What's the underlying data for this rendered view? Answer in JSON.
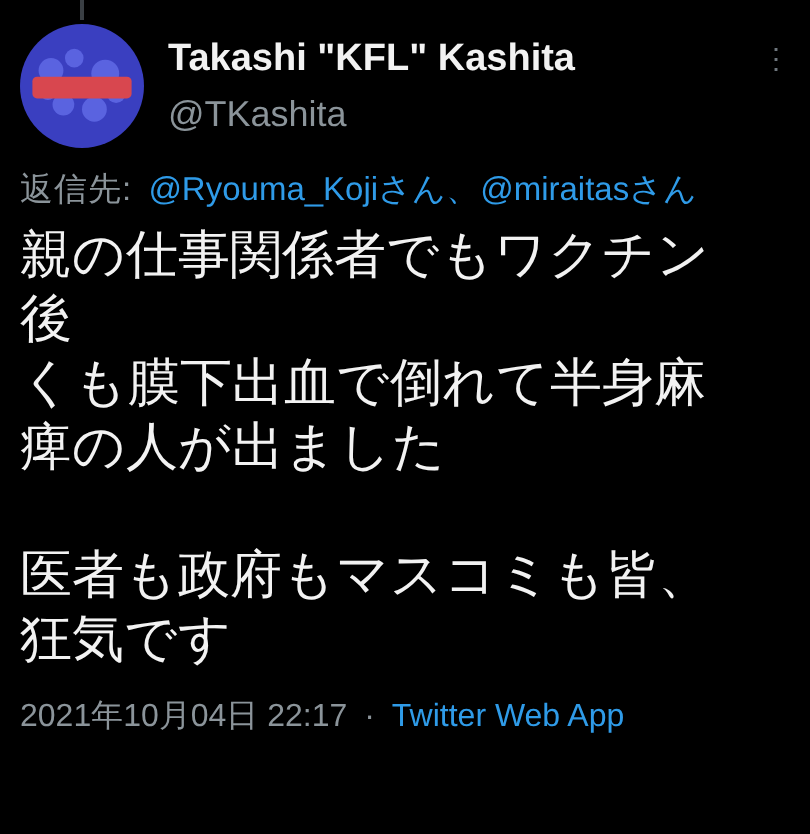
{
  "author": {
    "name": "Takashi \"KFL\" Kashita",
    "handle": "@TKashita"
  },
  "more_menu": "⋮",
  "reply_to": {
    "label": "返信先:",
    "mentions": [
      "@Ryouma_Kojiさん、",
      "@miraitasさん"
    ]
  },
  "body": [
    [
      "親の仕事関係者でもワクチン後",
      "くも膜下出血で倒れて半身麻痺の人が出ました"
    ],
    [
      "医者も政府もマスコミも皆、",
      "狂気です"
    ]
  ],
  "timestamp": "2021年10月04日 22:17",
  "separator": "·",
  "source": "Twitter Web App"
}
